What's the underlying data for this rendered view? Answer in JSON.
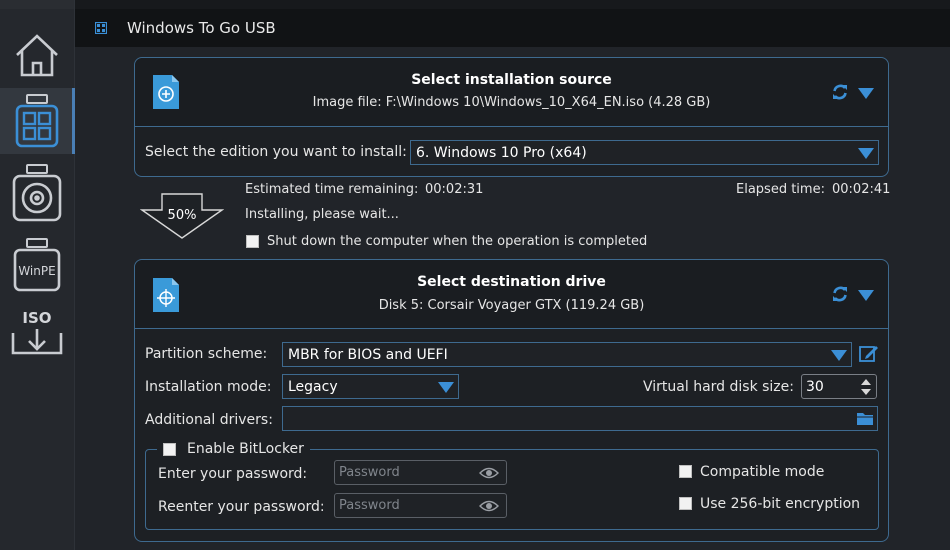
{
  "window": {
    "title": "Windows To Go USB"
  },
  "sidebar": {
    "items": [
      {
        "name": "home",
        "icon": "home-icon"
      },
      {
        "name": "windows-to-go",
        "icon": "windows-grid-icon"
      },
      {
        "name": "disk",
        "icon": "disk-icon"
      },
      {
        "name": "winpe",
        "icon": "winpe-icon",
        "label": "WinPE"
      },
      {
        "name": "iso",
        "icon": "iso-download-icon",
        "label": "ISO"
      }
    ]
  },
  "source": {
    "title": "Select installation source",
    "subtitle": "Image file: F:\\Windows 10\\Windows_10_X64_EN.iso (4.28 GB)",
    "edition_label": "Select the edition you want to install:",
    "edition_value": "6. Windows 10 Pro (x64)"
  },
  "progress": {
    "percent_text": "50%",
    "percent": 50,
    "remaining_label": "Estimated time remaining:",
    "remaining_value": "00:02:31",
    "elapsed_label": "Elapsed time:",
    "elapsed_value": "00:02:41",
    "status": "Installing, please wait...",
    "shutdown_label": "Shut down the computer when the operation is completed"
  },
  "destination": {
    "title": "Select destination drive",
    "subtitle": "Disk 5: Corsair Voyager GTX (119.24 GB)",
    "partition_label": "Partition scheme:",
    "partition_value": "MBR for BIOS and UEFI",
    "mode_label": "Installation mode:",
    "mode_value": "Legacy",
    "vhd_label": "Virtual hard disk size:",
    "vhd_value": "30",
    "drivers_label": "Additional drivers:",
    "drivers_value": ""
  },
  "bitlocker": {
    "enable_label": "Enable BitLocker",
    "password_label": "Enter your password:",
    "password_placeholder": "Password",
    "reenter_label": "Reenter your password:",
    "reenter_placeholder": "Password",
    "compatible_label": "Compatible mode",
    "encryption_label": "Use 256-bit encryption"
  },
  "colors": {
    "accent": "#3b8fd6",
    "border": "#3e6a8f",
    "background": "#212429"
  }
}
